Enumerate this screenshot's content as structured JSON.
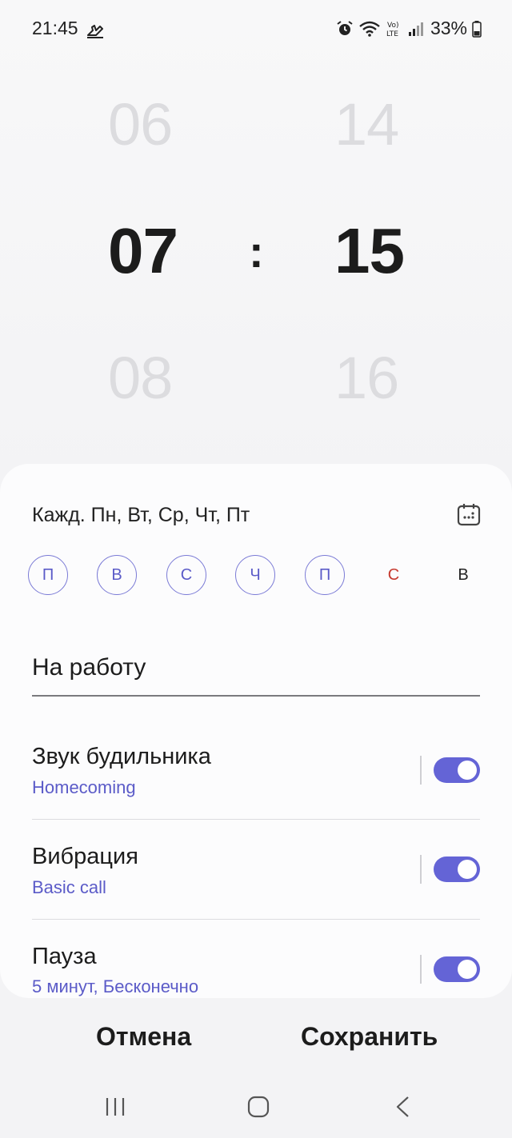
{
  "status_bar": {
    "time": "21:45",
    "battery": "33%",
    "icons": [
      "walking-person-icon",
      "alarm-icon",
      "wifi-icon",
      "volte-icon",
      "signal-icon",
      "battery-icon"
    ]
  },
  "picker": {
    "hours": {
      "prev": "06",
      "selected": "07",
      "next": "08"
    },
    "separator": ":",
    "minutes": {
      "prev": "14",
      "selected": "15",
      "next": "16"
    }
  },
  "repeat": {
    "summary": "Кажд. Пн, Вт, Ср, Чт, Пт",
    "days": [
      {
        "label": "П",
        "active": true
      },
      {
        "label": "В",
        "active": true
      },
      {
        "label": "С",
        "active": true
      },
      {
        "label": "Ч",
        "active": true
      },
      {
        "label": "П",
        "active": true
      },
      {
        "label": "С",
        "active": false
      },
      {
        "label": "В",
        "active": false
      }
    ]
  },
  "alarm_name": "На работу",
  "settings": [
    {
      "title": "Звук будильника",
      "subtitle": "Homecoming",
      "enabled": true
    },
    {
      "title": "Вибрация",
      "subtitle": "Basic call",
      "enabled": true
    },
    {
      "title": "Пауза",
      "subtitle": "5 минут, Бесконечно",
      "enabled": true
    }
  ],
  "actions": {
    "cancel": "Отмена",
    "save": "Сохранить"
  },
  "colors": {
    "accent": "#6464d6",
    "accent_text": "#5b5bc8",
    "saturday": "#c63a2f"
  }
}
